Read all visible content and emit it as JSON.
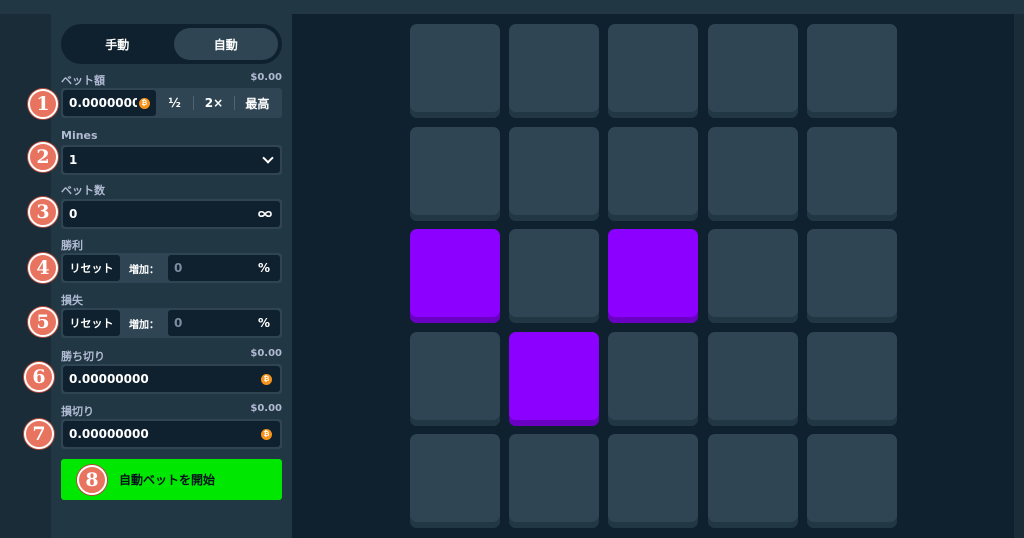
{
  "mode_toggle": {
    "manual": "手動",
    "auto": "自動",
    "active": "auto"
  },
  "bet_amount": {
    "label": "ベット額",
    "usd": "$0.00",
    "value": "0.0000000",
    "half": "½",
    "double": "2×",
    "max": "最高"
  },
  "mines": {
    "label": "Mines",
    "value": "1"
  },
  "bet_count": {
    "label": "ベット数",
    "value": "0",
    "icon": "infinity-icon"
  },
  "on_win": {
    "label": "勝利",
    "reset": "リセット",
    "increase": "増加：",
    "value": "0",
    "unit": "%"
  },
  "on_loss": {
    "label": "損失",
    "reset": "リセット",
    "increase": "増加：",
    "value": "0",
    "unit": "%"
  },
  "stop_profit": {
    "label": "勝ち切り",
    "usd": "$0.00",
    "value": "0.00000000"
  },
  "stop_loss": {
    "label": "損切り",
    "usd": "$0.00",
    "value": "0.00000000"
  },
  "start_button": {
    "label": "自動ベットを開始"
  },
  "badges": [
    "1",
    "2",
    "3",
    "4",
    "5",
    "6",
    "7",
    "8"
  ],
  "colors": {
    "accent_green": "#00e701",
    "selected_tile": "#8c00ff",
    "tile": "#2f4553",
    "badge": "#e8735f"
  },
  "grid": {
    "rows": 5,
    "cols": 5,
    "selected": [
      [
        2,
        0
      ],
      [
        2,
        2
      ],
      [
        3,
        1
      ]
    ]
  }
}
